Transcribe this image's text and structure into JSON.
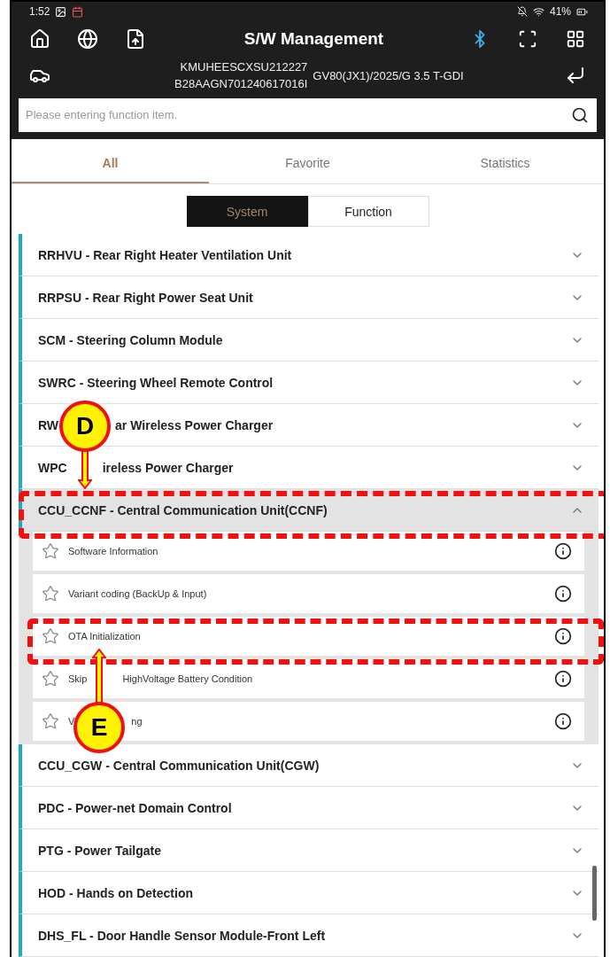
{
  "status_bar": {
    "time": "1:52",
    "battery": "41%"
  },
  "header": {
    "title": "S/W Management"
  },
  "vehicle": {
    "vin": "KMUHEESCXSU212227",
    "code": "B28AAGN701240617016I",
    "model": "GV80(JX1)/2025/G 3.5 T-GDI"
  },
  "search": {
    "placeholder": "Please entering function item."
  },
  "tabs": [
    {
      "label": "All",
      "selected": true
    },
    {
      "label": "Favorite",
      "selected": false
    },
    {
      "label": "Statistics",
      "selected": false
    }
  ],
  "segments": [
    {
      "label": "System",
      "selected": true
    },
    {
      "label": "Function",
      "selected": false
    }
  ],
  "systems": [
    {
      "label_parts": [
        "RRHVU - Rear Right Heater Ventilation Unit"
      ],
      "expanded": false
    },
    {
      "label_parts": [
        "RRPSU - Rear Right Power Seat Unit"
      ],
      "expanded": false
    },
    {
      "label_parts": [
        "SCM - Steering Column Module"
      ],
      "expanded": false
    },
    {
      "label_parts": [
        "SWRC - Steering Wheel Remote Control"
      ],
      "expanded": false
    },
    {
      "label_parts": [
        "RW",
        "ar Wireless Power Charger"
      ],
      "expanded": false,
      "callout": {
        "letter": "D",
        "arrow_down": true
      }
    },
    {
      "label_parts": [
        "WPC",
        "ireless Power Charger"
      ],
      "expanded": false
    },
    {
      "label_parts": [
        "CCU_CCNF - Central Communication Unit(CCNF)"
      ],
      "expanded": true,
      "highlighted": true,
      "children": [
        {
          "label_parts": [
            "Software Information"
          ],
          "favorite": false
        },
        {
          "label_parts": [
            "Variant coding (BackUp & Input)"
          ],
          "favorite": false
        },
        {
          "label_parts": [
            "OTA Initialization"
          ],
          "favorite": false,
          "highlighted": true
        },
        {
          "label_parts": [
            "Skip",
            "HighVoltage Battery Condition"
          ],
          "favorite": false
        },
        {
          "label_parts": [
            "V",
            "ng"
          ],
          "favorite": false,
          "callout": {
            "letter": "E",
            "arrow_down": false
          }
        }
      ]
    },
    {
      "label_parts": [
        "CCU_CGW - Central Communication Unit(CGW)"
      ],
      "expanded": false
    },
    {
      "label_parts": [
        "PDC - Power-net Domain Control"
      ],
      "expanded": false
    },
    {
      "label_parts": [
        "PTG - Power Tailgate"
      ],
      "expanded": false
    },
    {
      "label_parts": [
        "HOD - Hands on Detection"
      ],
      "expanded": false
    },
    {
      "label_parts": [
        "DHS_FL - Door Handle Sensor Module-Front Left"
      ],
      "expanded": false
    }
  ]
}
